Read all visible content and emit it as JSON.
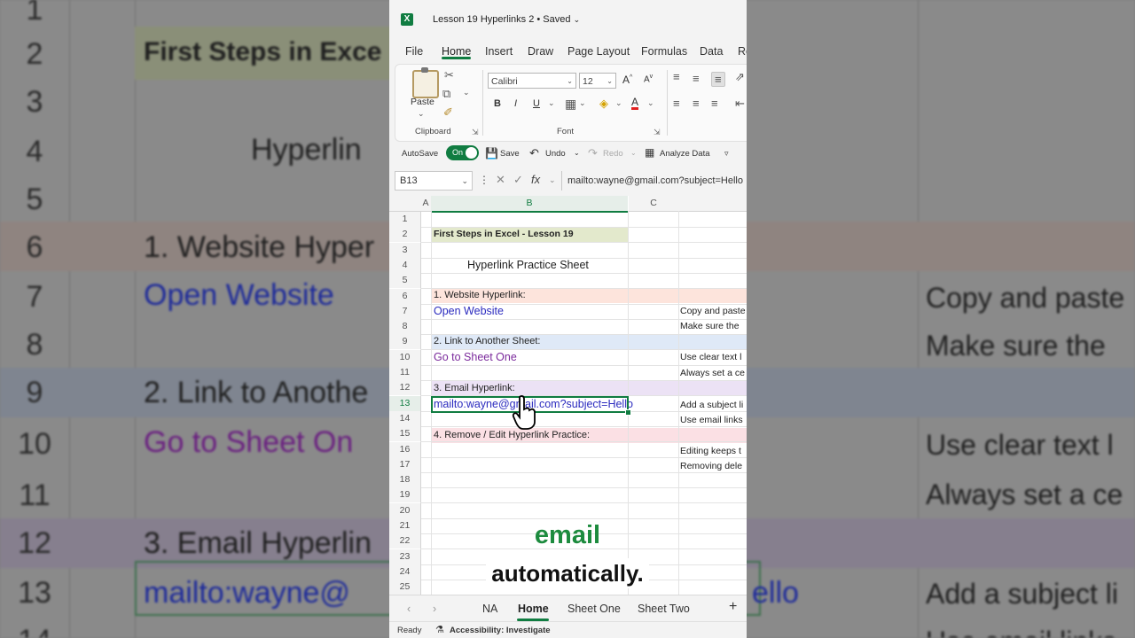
{
  "background": {
    "rows": [
      {
        "num": "1",
        "text": "",
        "right": ""
      },
      {
        "num": "2",
        "text": "First Steps in Exce",
        "right": ""
      },
      {
        "num": "3",
        "text": "",
        "right": ""
      },
      {
        "num": "4",
        "text": "Hyperlin",
        "right": ""
      },
      {
        "num": "5",
        "text": "",
        "right": ""
      },
      {
        "num": "6",
        "text": "1. Website Hyper",
        "right": ""
      },
      {
        "num": "7",
        "text": "Open Website",
        "right": "Copy and paste"
      },
      {
        "num": "8",
        "text": "",
        "right": "Make sure the"
      },
      {
        "num": "9",
        "text": "2. Link to Anothe",
        "right": ""
      },
      {
        "num": "10",
        "text": "Go to Sheet On",
        "right": "Use clear text l"
      },
      {
        "num": "11",
        "text": "",
        "right": "Always set a ce"
      },
      {
        "num": "12",
        "text": "3. Email Hyperlin",
        "right": ""
      },
      {
        "num": "13",
        "text": "mailto:wayne@",
        "right": "Add a subject li"
      },
      {
        "num": "14",
        "text": "",
        "right": "Use email links"
      }
    ],
    "row13_tail": "ello"
  },
  "titlebar": {
    "logo": "X",
    "doc_title": "Lesson 19 Hyperlinks 2 • Saved"
  },
  "ribbon_tabs": [
    "File",
    "Home",
    "Insert",
    "Draw",
    "Page Layout",
    "Formulas",
    "Data",
    "Re"
  ],
  "ribbon": {
    "paste_label": "Paste",
    "font_name": "Calibri",
    "font_size": "12",
    "grow_font": "A",
    "shrink_font": "A",
    "bold": "B",
    "italic": "I",
    "underline": "U",
    "font_color": "A",
    "clipboard_label": "Clipboard",
    "font_label": "Font"
  },
  "qat": {
    "autosave_label": "AutoSave",
    "toggle_label": "On",
    "save_label": "Save",
    "undo_label": "Undo",
    "redo_label": "Redo",
    "analyze_label": "Analyze Data"
  },
  "formula_bar": {
    "name_box": "B13",
    "fx": "fx",
    "content": "mailto:wayne@gmail.com?subject=Hello"
  },
  "columns": [
    "A",
    "B",
    "C"
  ],
  "row_numbers": [
    "1",
    "2",
    "3",
    "4",
    "5",
    "6",
    "7",
    "8",
    "9",
    "10",
    "11",
    "12",
    "13",
    "14",
    "15",
    "16",
    "17",
    "18",
    "19",
    "20",
    "21",
    "22",
    "23",
    "24",
    "25"
  ],
  "cells": {
    "b2": "First Steps in Excel - Lesson 19",
    "b4": "Hyperlink Practice Sheet",
    "b6": "1. Website Hyperlink:",
    "b7": "Open Website",
    "d7": "Copy and paste",
    "d8": "Make sure the",
    "b9": "2. Link to Another Sheet:",
    "b10": "Go to Sheet One",
    "d10": "Use clear text l",
    "d11": "Always set a ce",
    "b12": "3. Email Hyperlink:",
    "b13": "mailto:wayne@gmail.com?subject=Hello",
    "d13": "Add a subject li",
    "d14": "Use email links",
    "b15": "4. Remove / Edit Hyperlink Practice:",
    "d16": "Editing keeps t",
    "d17": "Removing dele"
  },
  "colors": {
    "title_fill": "#e3e9cc",
    "section1_fill": "#fde4dc",
    "section2_fill": "#dfe9f7",
    "section3_fill": "#ece2f5",
    "section4_fill": "#fbe0e4",
    "accent": "#107c41"
  },
  "sheet_tabs": [
    "NA",
    "Home",
    "Sheet One",
    "Sheet Two"
  ],
  "status": {
    "ready": "Ready",
    "accessibility": "Accessibility: Investigate"
  },
  "captions": {
    "line1": "email",
    "line2": "automatically."
  }
}
